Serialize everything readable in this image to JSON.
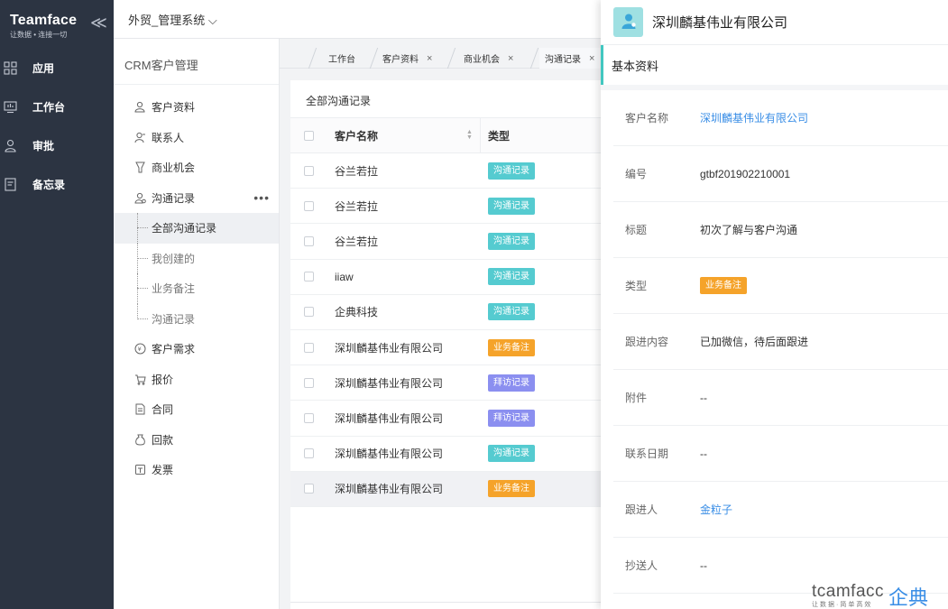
{
  "brand": {
    "name": "Teamface",
    "slogan": "让数据 • 连接一切",
    "collapse_glyph": "≪"
  },
  "nav": [
    {
      "label": "应用",
      "icon": "apps-icon"
    },
    {
      "label": "工作台",
      "icon": "monitor-icon"
    },
    {
      "label": "审批",
      "icon": "user-check-icon"
    },
    {
      "label": "备忘录",
      "icon": "memo-icon"
    }
  ],
  "topbar": {
    "system_title": "外贸_管理系统 ⌵"
  },
  "sidebar": {
    "title": "CRM客户管理",
    "items": [
      {
        "label": "客户资料",
        "icon": "customer-icon"
      },
      {
        "label": "联系人",
        "icon": "contact-icon"
      },
      {
        "label": "商业机会",
        "icon": "opportunity-icon"
      },
      {
        "label": "沟通记录",
        "icon": "communication-icon",
        "more": "•••"
      }
    ],
    "sub_items": [
      {
        "label": "全部沟通记录",
        "active": true
      },
      {
        "label": "我创建的"
      },
      {
        "label": "业务备注"
      },
      {
        "label": "沟通记录"
      }
    ],
    "items_after": [
      {
        "label": "客户需求",
        "icon": "demand-icon"
      },
      {
        "label": "报价",
        "icon": "cart-icon"
      },
      {
        "label": "合同",
        "icon": "contract-icon"
      },
      {
        "label": "回款",
        "icon": "money-bag-icon"
      },
      {
        "label": "发票",
        "icon": "invoice-icon"
      }
    ]
  },
  "tabs": [
    {
      "label": "工作台"
    },
    {
      "label": "客户资料",
      "close": "×"
    },
    {
      "label": "商业机会",
      "close": "×"
    },
    {
      "label": "沟通记录",
      "close": "×"
    }
  ],
  "list": {
    "title": "全部沟通记录",
    "headers": {
      "name": "客户名称",
      "type": "类型"
    },
    "rows": [
      {
        "name": "谷兰若拉",
        "type": "沟通记录",
        "color": "#55cbd0"
      },
      {
        "name": "谷兰若拉",
        "type": "沟通记录",
        "color": "#55cbd0"
      },
      {
        "name": "谷兰若拉",
        "type": "沟通记录",
        "color": "#55cbd0"
      },
      {
        "name": "iiaw",
        "type": "沟通记录",
        "color": "#55cbd0"
      },
      {
        "name": "企典科技",
        "type": "沟通记录",
        "color": "#55cbd0"
      },
      {
        "name": "深圳麟基伟业有限公司",
        "type": "业务备注",
        "color": "#f5a32a"
      },
      {
        "name": "深圳麟基伟业有限公司",
        "type": "拜访记录",
        "color": "#8b8ff0"
      },
      {
        "name": "深圳麟基伟业有限公司",
        "type": "拜访记录",
        "color": "#8b8ff0"
      },
      {
        "name": "深圳麟基伟业有限公司",
        "type": "沟通记录",
        "color": "#55cbd0"
      },
      {
        "name": "深圳麟基伟业有限公司",
        "type": "业务备注",
        "color": "#f5a32a",
        "selected": true
      }
    ]
  },
  "detail": {
    "company": "深圳麟基伟业有限公司",
    "section": "基本资料",
    "fields": [
      {
        "label": "客户名称",
        "value": "深圳麟基伟业有限公司",
        "kind": "link"
      },
      {
        "label": "编号",
        "value": "gtbf201902210001"
      },
      {
        "label": "标题",
        "value": "初次了解与客户沟通"
      },
      {
        "label": "类型",
        "value": "业务备注",
        "kind": "badge",
        "color": "#f5a32a"
      },
      {
        "label": "跟进内容",
        "value": "已加微信，待后面跟进"
      },
      {
        "label": "附件",
        "value": "--"
      },
      {
        "label": "联系日期",
        "value": "--"
      },
      {
        "label": "跟进人",
        "value": "金粒子",
        "kind": "link"
      },
      {
        "label": "抄送人",
        "value": "--"
      }
    ]
  },
  "watermark": {
    "en": "tcamfacc",
    "sub": "让数据·简单高效",
    "cn": "企典"
  },
  "colors": {
    "nav_bg": "#2c3442",
    "accent": "#41c7c0",
    "link": "#3a8ee6"
  }
}
